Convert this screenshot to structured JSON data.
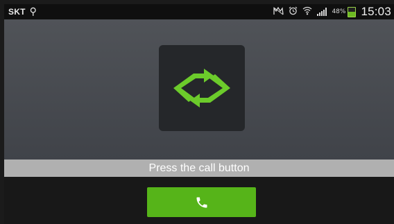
{
  "status_bar": {
    "carrier": "SKT",
    "usb_icon": "usb-icon",
    "icons": [
      "silent-mode-icon",
      "alarm-icon",
      "wifi-icon",
      "signal-icon"
    ],
    "battery_percent_text": "48%",
    "battery_level": 0.48,
    "time": "15:03"
  },
  "app": {
    "logo_icon": "sync-arrows-icon",
    "logo_color": "#6ccb2b",
    "prompt_text": "Press the call button",
    "call_button_icon": "phone-icon",
    "call_button_color": "#56b419"
  }
}
